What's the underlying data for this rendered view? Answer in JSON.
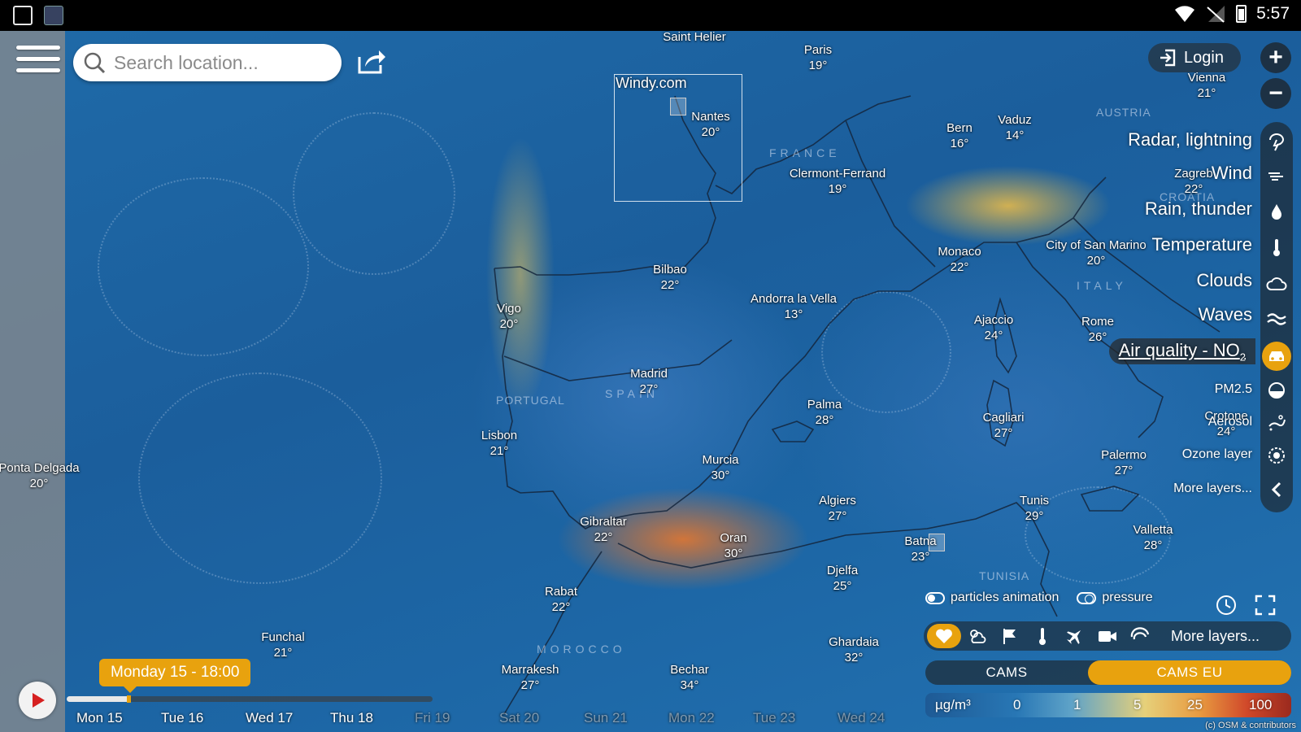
{
  "status_bar": {
    "time": "5:57"
  },
  "search": {
    "placeholder": "Search location..."
  },
  "map": {
    "watermark": "Windy.com",
    "countries": [
      {
        "name": "FRANCE"
      },
      {
        "name": "SPAIN"
      },
      {
        "name": "PORTUGAL"
      },
      {
        "name": "ITALY"
      },
      {
        "name": "AUSTRIA"
      },
      {
        "name": "CROATIA"
      },
      {
        "name": "MOROCCO"
      },
      {
        "name": "TUNISIA"
      }
    ],
    "cities": [
      {
        "name": "Saint Helier",
        "temp": ""
      },
      {
        "name": "Paris",
        "temp": "19°"
      },
      {
        "name": "Nantes",
        "temp": "20°"
      },
      {
        "name": "Vienna",
        "temp": "21°"
      },
      {
        "name": "Bern",
        "temp": "16°"
      },
      {
        "name": "Vaduz",
        "temp": "14°"
      },
      {
        "name": "Clermont-Ferrand",
        "temp": "19°"
      },
      {
        "name": "Zagreb",
        "temp": "22°"
      },
      {
        "name": "Monaco",
        "temp": "22°"
      },
      {
        "name": "City of San Marino",
        "temp": "20°"
      },
      {
        "name": "Bilbao",
        "temp": "22°"
      },
      {
        "name": "Andorra la Vella",
        "temp": "13°"
      },
      {
        "name": "Vigo",
        "temp": "20°"
      },
      {
        "name": "Ajaccio",
        "temp": "24°"
      },
      {
        "name": "Rome",
        "temp": "26°"
      },
      {
        "name": "Madrid",
        "temp": "27°"
      },
      {
        "name": "Palma",
        "temp": "28°"
      },
      {
        "name": "Cagliari",
        "temp": "27°"
      },
      {
        "name": "Lisbon",
        "temp": "21°"
      },
      {
        "name": "Ponta Delgada",
        "temp": "20°"
      },
      {
        "name": "Murcia",
        "temp": "30°"
      },
      {
        "name": "Crotone",
        "temp": "24°"
      },
      {
        "name": "Palermo",
        "temp": "27°"
      },
      {
        "name": "Gibraltar",
        "temp": "22°"
      },
      {
        "name": "Algiers",
        "temp": "27°"
      },
      {
        "name": "Tunis",
        "temp": "29°"
      },
      {
        "name": "Oran",
        "temp": "30°"
      },
      {
        "name": "Batna",
        "temp": "23°"
      },
      {
        "name": "Valletta",
        "temp": "28°"
      },
      {
        "name": "Djelfa",
        "temp": "25°"
      },
      {
        "name": "Rabat",
        "temp": "22°"
      },
      {
        "name": "Funchal",
        "temp": "21°"
      },
      {
        "name": "Ghardaia",
        "temp": "32°"
      },
      {
        "name": "Marrakesh",
        "temp": "27°"
      },
      {
        "name": "Bechar",
        "temp": "34°"
      }
    ]
  },
  "header": {
    "login_label": "Login"
  },
  "zoom": {
    "in": "+",
    "out": "−"
  },
  "layers": [
    {
      "label": "Radar, lightning",
      "icon": "radar-icon"
    },
    {
      "label": "Wind",
      "icon": "wind-icon"
    },
    {
      "label": "Rain, thunder",
      "icon": "rain-icon"
    },
    {
      "label": "Temperature",
      "icon": "thermometer-icon"
    },
    {
      "label": "Clouds",
      "icon": "cloud-icon"
    },
    {
      "label": "Waves",
      "icon": "waves-icon"
    },
    {
      "label": "Air quality - NO",
      "sub": "2",
      "icon": "car-icon",
      "active": true
    },
    {
      "label": "PM2.5",
      "icon": "pm25-icon"
    },
    {
      "label": "Aerosol",
      "icon": "aerosol-icon"
    },
    {
      "label": "Ozone layer",
      "icon": "ozone-icon"
    },
    {
      "label": "More layers...",
      "icon": "chevron-left-icon"
    }
  ],
  "controls": {
    "particles_label": "particles animation",
    "pressure_label": "pressure",
    "more_layers": "More layers..."
  },
  "models": [
    {
      "label": "CAMS",
      "active": false
    },
    {
      "label": "CAMS EU",
      "active": true
    }
  ],
  "legend": {
    "unit": "µg/m³",
    "stops": [
      "0",
      "1",
      "5",
      "25",
      "100"
    ],
    "colors": [
      "#1e5a95",
      "#2877b5",
      "#5fa3c8",
      "#e6d07a",
      "#e89a40",
      "#d0482a",
      "#9b2a1e"
    ]
  },
  "copyright": "(c) OSM & contributors",
  "timeline": {
    "current": "Monday 15 - 18:00",
    "progress_fraction": 0.17,
    "days": [
      {
        "label": "Mon 15",
        "dim": false
      },
      {
        "label": "Tue 16",
        "dim": false
      },
      {
        "label": "Wed 17",
        "dim": false
      },
      {
        "label": "Thu 18",
        "dim": false
      },
      {
        "label": "Fri 19",
        "dim": true
      },
      {
        "label": "Sat 20",
        "dim": true
      },
      {
        "label": "Sun 21",
        "dim": true
      },
      {
        "label": "Mon 22",
        "dim": true
      },
      {
        "label": "Tue 23",
        "dim": true
      },
      {
        "label": "Wed 24",
        "dim": true
      }
    ]
  },
  "colors": {
    "accent": "#e8a20e",
    "sea": "#1f6aa8"
  }
}
